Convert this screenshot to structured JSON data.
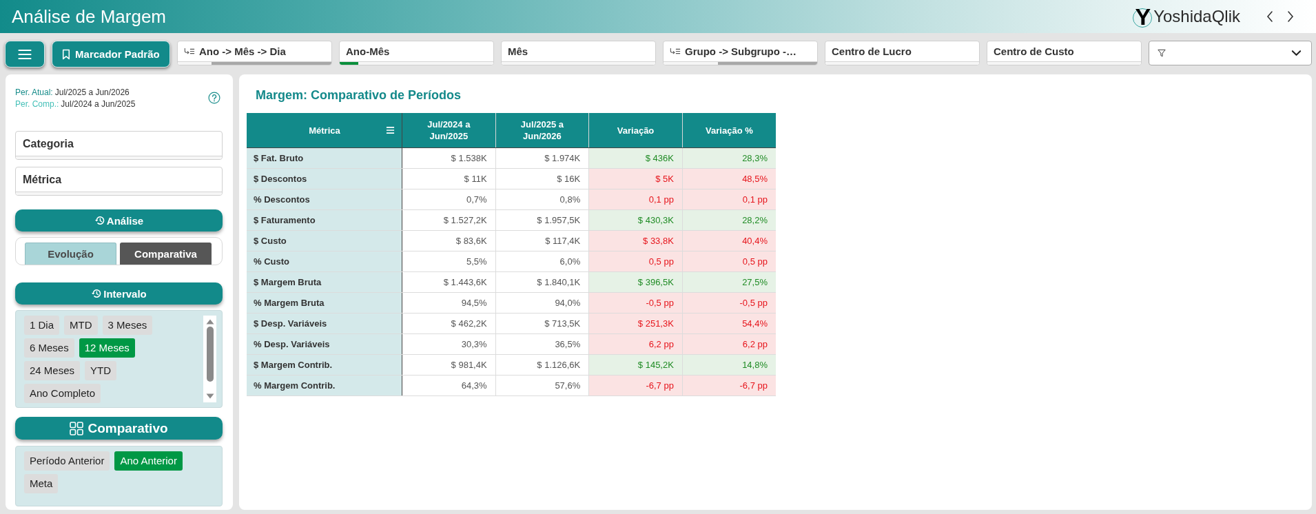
{
  "header": {
    "title": "Análise de Margem",
    "logo": {
      "mark": "Y",
      "name": "YoshidaQlik"
    }
  },
  "toolbar": {
    "bookmark_button": {
      "label": "Marcador Padrão"
    },
    "filters": [
      {
        "label": "Ano -> Mês -> Dia",
        "kind": "drilldown",
        "selection_bar": {
          "kind": "excluded",
          "level": 0.78
        }
      },
      {
        "label": "Ano-Mês",
        "kind": "field",
        "selection_bar": {
          "kind": "selected",
          "level": 0.12
        }
      },
      {
        "label": "Mês",
        "kind": "field"
      },
      {
        "label": "Grupo -> Subgrupo -…",
        "kind": "drilldown",
        "selection_bar": {
          "kind": "excluded",
          "level": 0.645
        }
      },
      {
        "label": "Centro de Lucro",
        "kind": "field"
      },
      {
        "label": "Centro de Custo",
        "kind": "field"
      }
    ]
  },
  "left_panel": {
    "period_lines": [
      {
        "label": "Per. Atual:",
        "value": "Jul/2025 a Jun/2026",
        "color": "#178c8a"
      },
      {
        "label": "Per. Comp.:",
        "value": "Jul/2024 a Jun/2025",
        "color": "#45c0b8"
      }
    ],
    "fields": [
      {
        "label": "Categoria"
      },
      {
        "label": "Métrica"
      }
    ],
    "analysis": {
      "title": "Análise",
      "options": [
        {
          "label": "Evolução",
          "selected": false
        },
        {
          "label": "Comparativa",
          "selected": true
        }
      ]
    },
    "interval": {
      "title": "Intervalo",
      "options": [
        {
          "label": "1 Dia",
          "selected": false
        },
        {
          "label": "MTD",
          "selected": false
        },
        {
          "label": "3 Meses",
          "selected": false
        },
        {
          "label": "6 Meses",
          "selected": false
        },
        {
          "label": "12 Meses",
          "selected": true
        },
        {
          "label": "24 Meses",
          "selected": false
        },
        {
          "label": "YTD",
          "selected": false
        },
        {
          "label": "Ano Completo",
          "selected": false
        }
      ]
    },
    "comparison": {
      "title": "Comparativo",
      "options": [
        {
          "label": "Período Anterior",
          "selected": false
        },
        {
          "label": "Ano Anterior",
          "selected": true
        },
        {
          "label": "Meta",
          "selected": false
        }
      ]
    }
  },
  "main_panel": {
    "title": "Margem: Comparativo de Períodos",
    "table": {
      "columns": [
        {
          "label": "Métrica"
        },
        {
          "label": "Jul/2024 a Jun/2025"
        },
        {
          "label": "Jul/2025 a Jun/2026"
        },
        {
          "label": "Variação"
        },
        {
          "label": "Variação %"
        }
      ],
      "rows": [
        {
          "metric": "$ Fat. Bruto",
          "values": [
            "$ 1.538K",
            "$ 1.974K"
          ],
          "variation": "$ 436K",
          "variation_pct": "28,3%",
          "favorable": true
        },
        {
          "metric": "$ Descontos",
          "values": [
            "$ 11K",
            "$ 16K"
          ],
          "variation": "$ 5K",
          "variation_pct": "48,5%",
          "favorable": false
        },
        {
          "metric": "% Descontos",
          "values": [
            "0,7%",
            "0,8%"
          ],
          "variation": "0,1 pp",
          "variation_pct": "0,1 pp",
          "favorable": false
        },
        {
          "metric": "$ Faturamento",
          "values": [
            "$ 1.527,2K",
            "$ 1.957,5K"
          ],
          "variation": "$ 430,3K",
          "variation_pct": "28,2%",
          "favorable": true
        },
        {
          "metric": "$ Custo",
          "values": [
            "$ 83,6K",
            "$ 117,4K"
          ],
          "variation": "$ 33,8K",
          "variation_pct": "40,4%",
          "favorable": false
        },
        {
          "metric": "% Custo",
          "values": [
            "5,5%",
            "6,0%"
          ],
          "variation": "0,5 pp",
          "variation_pct": "0,5 pp",
          "favorable": false
        },
        {
          "metric": "$ Margem Bruta",
          "values": [
            "$ 1.443,6K",
            "$ 1.840,1K"
          ],
          "variation": "$ 396,5K",
          "variation_pct": "27,5%",
          "favorable": true
        },
        {
          "metric": "% Margem Bruta",
          "values": [
            "94,5%",
            "94,0%"
          ],
          "variation": "-0,5 pp",
          "variation_pct": "-0,5 pp",
          "favorable": false
        },
        {
          "metric": "$ Desp. Variáveis",
          "values": [
            "$ 462,2K",
            "$ 713,5K"
          ],
          "variation": "$ 251,3K",
          "variation_pct": "54,4%",
          "favorable": false
        },
        {
          "metric": "% Desp. Variáveis",
          "values": [
            "30,3%",
            "36,5%"
          ],
          "variation": "6,2 pp",
          "variation_pct": "6,2 pp",
          "favorable": false
        },
        {
          "metric": "$ Margem Contrib.",
          "values": [
            "$ 981,4K",
            "$ 1.126,6K"
          ],
          "variation": "$ 145,2K",
          "variation_pct": "14,8%",
          "favorable": true
        },
        {
          "metric": "% Margem Contrib.",
          "values": [
            "64,3%",
            "57,6%"
          ],
          "variation": "-6,7 pp",
          "variation_pct": "-6,7 pp",
          "favorable": false
        }
      ]
    }
  }
}
